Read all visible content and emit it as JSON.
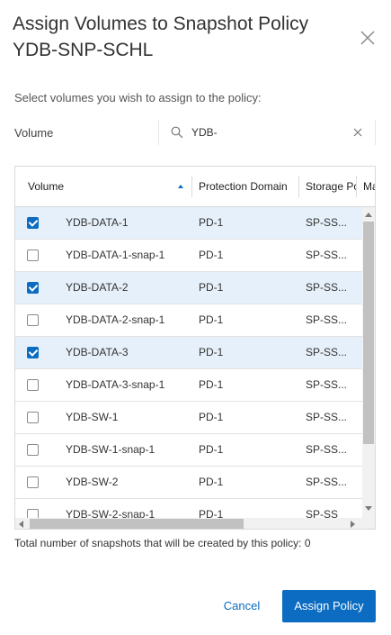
{
  "dialog": {
    "title": "Assign Volumes to Snapshot Policy YDB-SNP-SCHL",
    "subtitle": "Select volumes you wish to assign to the policy:"
  },
  "filter": {
    "label": "Volume",
    "search_value": "YDB-",
    "search_icon": "search-icon",
    "clear_icon": "close-icon"
  },
  "table": {
    "columns": [
      "Volume",
      "Protection Domain",
      "Storage Pool",
      "Ma"
    ],
    "sort": {
      "column": "Volume",
      "direction": "ascending"
    },
    "rows": [
      {
        "volume": "YDB-DATA-1",
        "protection_domain": "PD-1",
        "storage_pool": "SP-SS...",
        "checked": true
      },
      {
        "volume": "YDB-DATA-1-snap-1",
        "protection_domain": "PD-1",
        "storage_pool": "SP-SS...",
        "checked": false
      },
      {
        "volume": "YDB-DATA-2",
        "protection_domain": "PD-1",
        "storage_pool": "SP-SS...",
        "checked": true
      },
      {
        "volume": "YDB-DATA-2-snap-1",
        "protection_domain": "PD-1",
        "storage_pool": "SP-SS...",
        "checked": false
      },
      {
        "volume": "YDB-DATA-3",
        "protection_domain": "PD-1",
        "storage_pool": "SP-SS...",
        "checked": true
      },
      {
        "volume": "YDB-DATA-3-snap-1",
        "protection_domain": "PD-1",
        "storage_pool": "SP-SS...",
        "checked": false
      },
      {
        "volume": "YDB-SW-1",
        "protection_domain": "PD-1",
        "storage_pool": "SP-SS...",
        "checked": false
      },
      {
        "volume": "YDB-SW-1-snap-1",
        "protection_domain": "PD-1",
        "storage_pool": "SP-SS...",
        "checked": false
      },
      {
        "volume": "YDB-SW-2",
        "protection_domain": "PD-1",
        "storage_pool": "SP-SS...",
        "checked": false
      },
      {
        "volume": "YDB-SW-2-snap-1",
        "protection_domain": "PD-1",
        "storage_pool": "SP-SS",
        "checked": false
      }
    ]
  },
  "summary": {
    "text": "Total number of snapshots that will be created by this policy: 0"
  },
  "actions": {
    "cancel_label": "Cancel",
    "assign_label": "Assign Policy"
  },
  "colors": {
    "accent": "#0b6cc1",
    "selected_row": "#e6f0fa"
  }
}
